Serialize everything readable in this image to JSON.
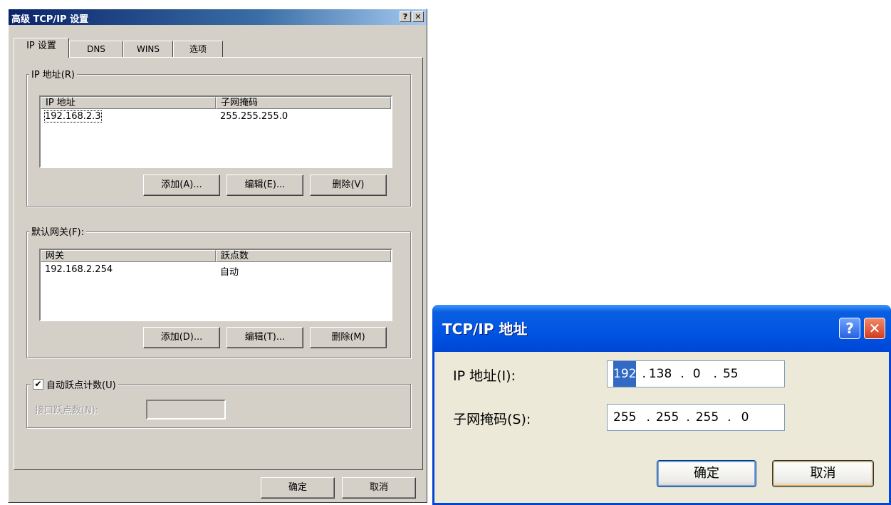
{
  "advanced_dialog": {
    "title": "高级 TCP/IP 设置",
    "help_label": "?",
    "close_label": "✕",
    "tabs": [
      {
        "label": "IP 设置",
        "active": true
      },
      {
        "label": "DNS",
        "active": false
      },
      {
        "label": "WINS",
        "active": false
      },
      {
        "label": "选项",
        "active": false
      }
    ],
    "ip_group": {
      "legend": "IP 地址(R)",
      "headers": [
        "IP 地址",
        "子网掩码"
      ],
      "rows": [
        {
          "ip": "192.168.2.3",
          "mask": "255.255.255.0"
        }
      ],
      "add_label": "添加(A)...",
      "edit_label": "编辑(E)...",
      "delete_label": "删除(V)"
    },
    "gateway_group": {
      "legend": "默认网关(F):",
      "headers": [
        "网关",
        "跃点数"
      ],
      "rows": [
        {
          "gateway": "192.168.2.254",
          "metric": "自动"
        }
      ],
      "add_label": "添加(D)...",
      "edit_label": "编辑(T)...",
      "delete_label": "删除(M)"
    },
    "auto_metric": {
      "label": "自动跃点计数(U)",
      "checked": true,
      "check_glyph": "✔",
      "interface_metric_label": "接口跃点数(N):",
      "interface_metric_value": ""
    },
    "ok_label": "确定",
    "cancel_label": "取消"
  },
  "tcpip_address_dialog": {
    "title": "TCP/IP 地址",
    "help_label": "?",
    "close_label": "✕",
    "ip_label": "IP 地址(I):",
    "ip_octets": [
      "192",
      "138",
      "0",
      "55"
    ],
    "mask_label": "子网掩码(S):",
    "mask_octets": [
      "255",
      "255",
      "255",
      "0"
    ],
    "ok_label": "确定",
    "cancel_label": "取消"
  },
  "colors": {
    "classic_title": "#0a246a",
    "classic_face": "#d4d0c8",
    "xp_title": "#0054e3",
    "xp_face": "#ece9d8",
    "xp_close": "#e04a2a",
    "selection": "#316ac5"
  }
}
